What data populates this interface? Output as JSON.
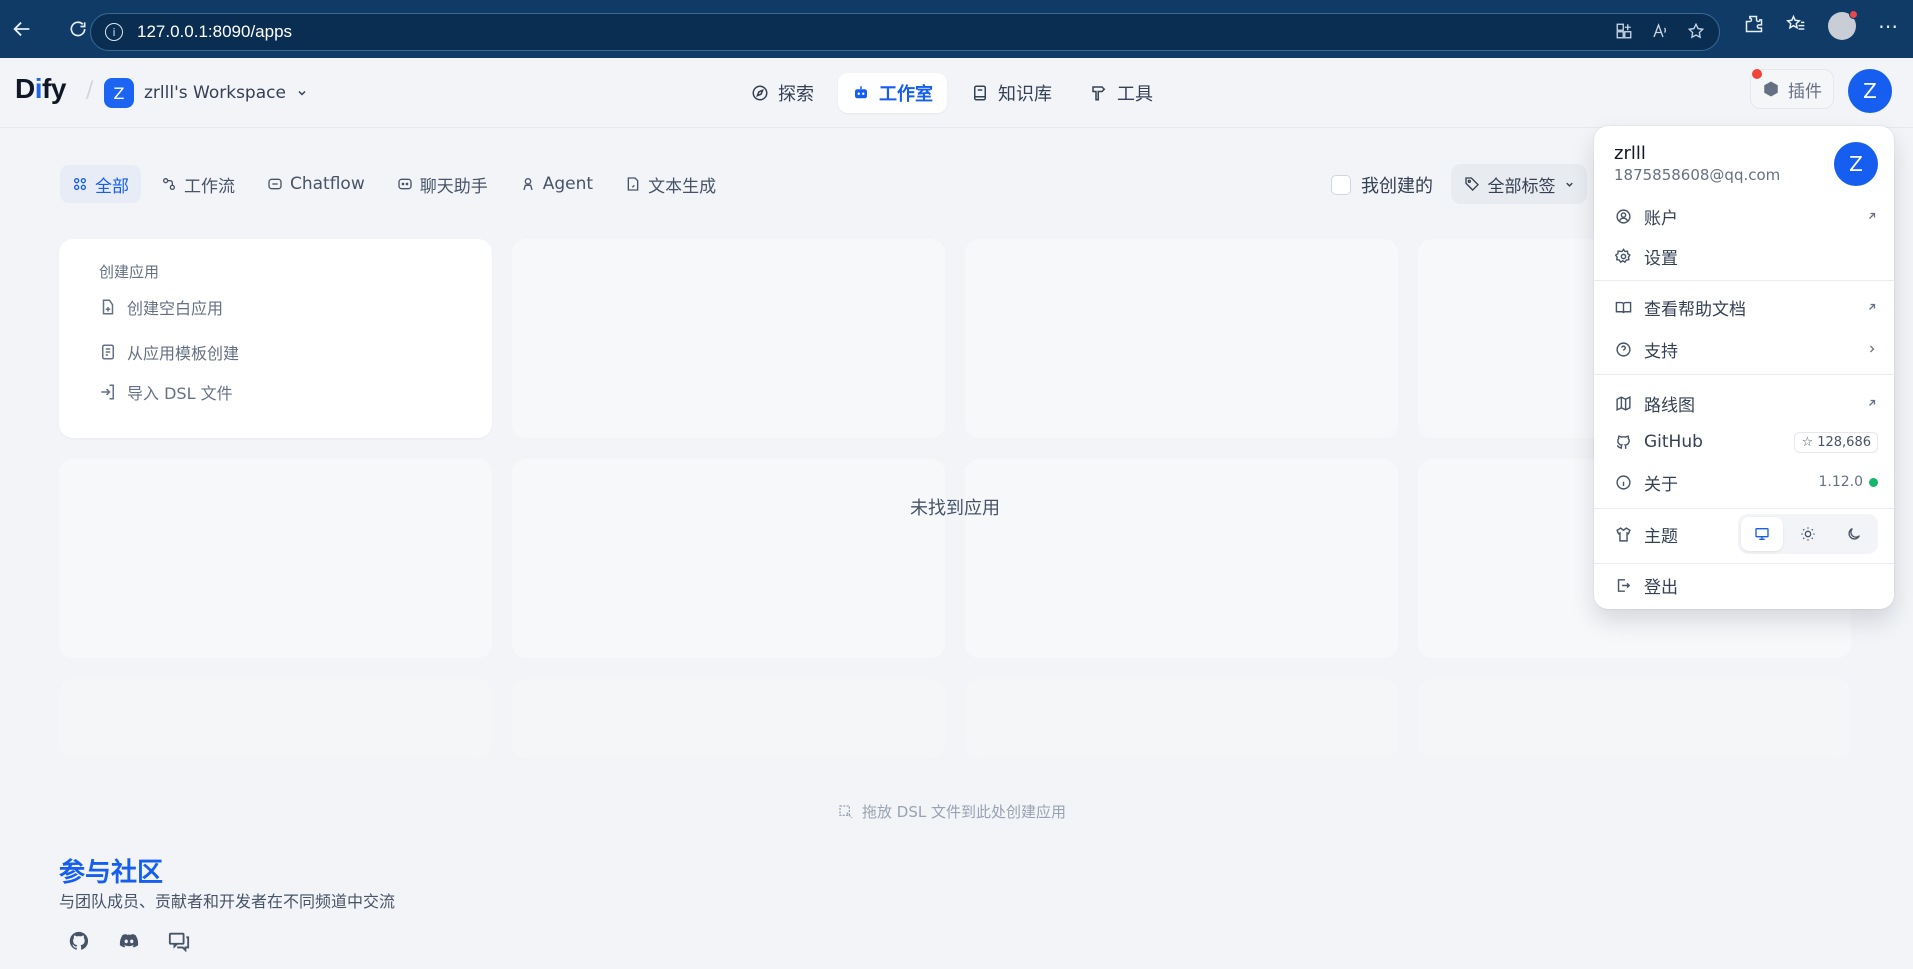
{
  "browser": {
    "url": "127.0.0.1:8090/apps"
  },
  "header": {
    "logo": "Dify",
    "workspace_badge": "Z",
    "workspace_name": "zrlll's Workspace",
    "nav": [
      {
        "label": "探索"
      },
      {
        "label": "工作室"
      },
      {
        "label": "知识库"
      },
      {
        "label": "工具"
      }
    ],
    "plugin_label": "插件",
    "avatar_letter": "Z"
  },
  "filters": {
    "tabs": [
      "全部",
      "工作流",
      "Chatflow",
      "聊天助手",
      "Agent",
      "文本生成"
    ],
    "mine_label": "我创建的",
    "tags_label": "全部标签"
  },
  "create_card": {
    "title": "创建应用",
    "options": [
      "创建空白应用",
      "从应用模板创建",
      "导入 DSL 文件"
    ]
  },
  "empty_message": "未找到应用",
  "drop_hint": "拖放 DSL 文件到此处创建应用",
  "community": {
    "title": "参与社区",
    "subtitle": "与团队成员、贡献者和开发者在不同频道中交流"
  },
  "dropdown": {
    "name": "zrlll",
    "email": "1875858608@qq.com",
    "avatar_letter": "Z",
    "account": "账户",
    "settings": "设置",
    "help_docs": "查看帮助文档",
    "support": "支持",
    "roadmap": "路线图",
    "github": "GitHub",
    "github_stars": "128,686",
    "about": "关于",
    "version": "1.12.0",
    "theme": "主题",
    "logout": "登出"
  },
  "colors": {
    "accent": "#155eef",
    "browser_bar": "#0f3b66",
    "status_green": "#12b76a"
  }
}
